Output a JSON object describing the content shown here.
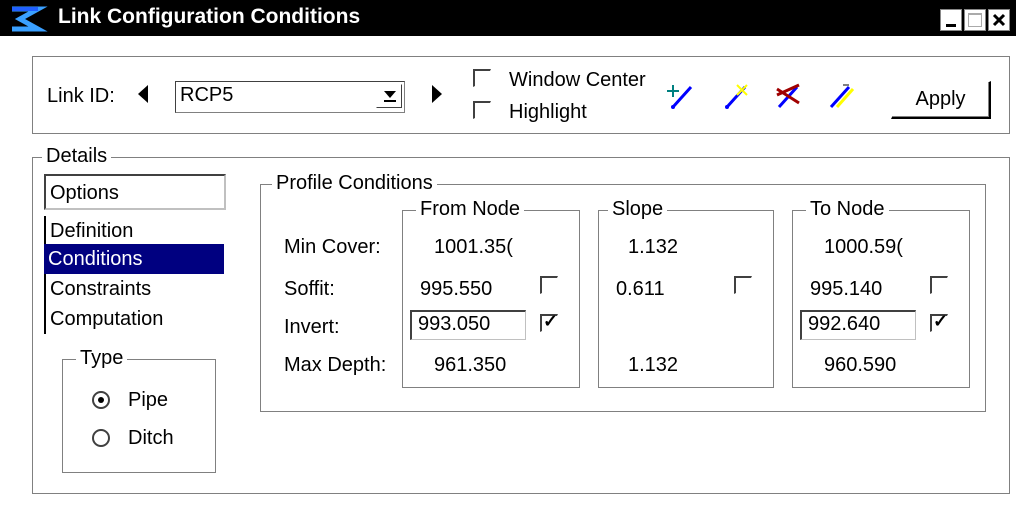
{
  "window": {
    "title": "Link Configuration Conditions",
    "controls": [
      "minimize-icon",
      "maximize-icon",
      "close-icon"
    ]
  },
  "toolbar": {
    "link_id_label": "Link ID:",
    "link_id_value": "RCP5",
    "window_center_label": "Window Center",
    "window_center_checked": false,
    "highlight_label": "Highlight",
    "highlight_checked": false,
    "tool_icons": [
      "add-link-icon",
      "edit-link-icon",
      "delete-link-icon",
      "link-settings-icon"
    ],
    "apply_label": "Apply"
  },
  "details": {
    "title": "Details",
    "nav_items": [
      {
        "label": "Options",
        "selected": false
      },
      {
        "label": "Definition",
        "selected": false
      },
      {
        "label": "Conditions",
        "selected": true
      },
      {
        "label": "Constraints",
        "selected": false
      },
      {
        "label": "Computation",
        "selected": false
      }
    ],
    "type": {
      "title": "Type",
      "options": [
        {
          "label": "Pipe",
          "selected": true
        },
        {
          "label": "Ditch",
          "selected": false
        }
      ]
    }
  },
  "profile": {
    "title": "Profile Conditions",
    "row_labels": {
      "min_cover": "Min Cover:",
      "soffit": "Soffit:",
      "invert": "Invert:",
      "max_depth": "Max Depth:"
    },
    "from_node": {
      "title": "From Node",
      "min_cover": "1001.35(",
      "soffit": "995.550",
      "soffit_checked": false,
      "invert": "993.050",
      "invert_checked": true,
      "max_depth": "961.350"
    },
    "slope": {
      "title": "Slope",
      "min_cover": "1.132",
      "soffit": "0.611",
      "soffit_checked": false,
      "max_depth": "1.132"
    },
    "to_node": {
      "title": "To Node",
      "min_cover": "1000.59(",
      "soffit": "995.140",
      "soffit_checked": false,
      "invert": "992.640",
      "invert_checked": true,
      "max_depth": "960.590"
    }
  },
  "colors": {
    "selection": "#000080",
    "titlebar": "#000000"
  }
}
